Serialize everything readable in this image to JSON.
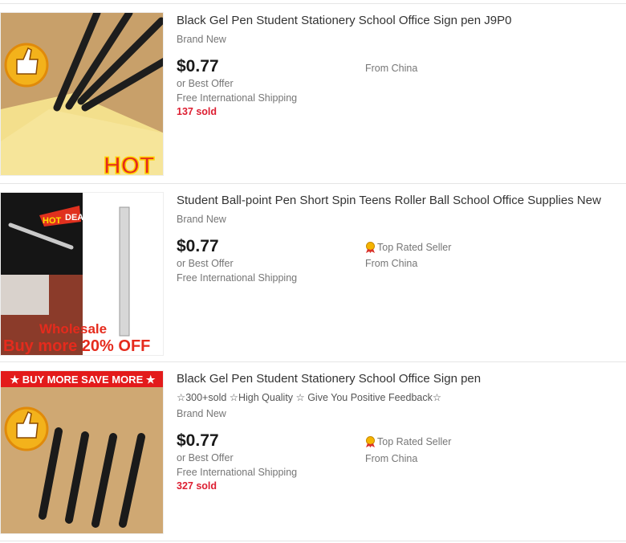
{
  "listings": [
    {
      "title": "Black Gel Pen Student Stationery School Office Sign pen J9P0",
      "condition": "Brand New",
      "price": "$0.77",
      "best_offer": "or Best Offer",
      "shipping": "Free International Shipping",
      "sold": "137 sold",
      "origin": "From China",
      "image_text": "HOT"
    },
    {
      "title": "Student Ball-point Pen Short Spin Teens Roller Ball School Office Supplies New",
      "condition": "Brand New",
      "price": "$0.77",
      "best_offer": "or Best Offer",
      "shipping": "Free International Shipping",
      "seller_badge": "Top Rated Seller",
      "origin": "From China",
      "image_text_1": "HOT",
      "image_text_2": "DEALS",
      "image_text_3": "Wholesale",
      "image_text_4": "Buy more 20% OFF"
    },
    {
      "title": "Black Gel Pen Student Stationery School Office Sign pen",
      "subtitle": "☆300+sold ☆High Quality ☆ Give You Positive Feedback☆",
      "condition": "Brand New",
      "price": "$0.77",
      "best_offer": "or Best Offer",
      "shipping": "Free International Shipping",
      "sold": "327 sold",
      "seller_badge": "Top Rated Seller",
      "origin": "From China",
      "image_text": "★ BUY MORE SAVE MORE ★"
    }
  ],
  "colors": {
    "sold": "#dd1e31",
    "price": "#191919",
    "secondary_text": "#767676"
  }
}
